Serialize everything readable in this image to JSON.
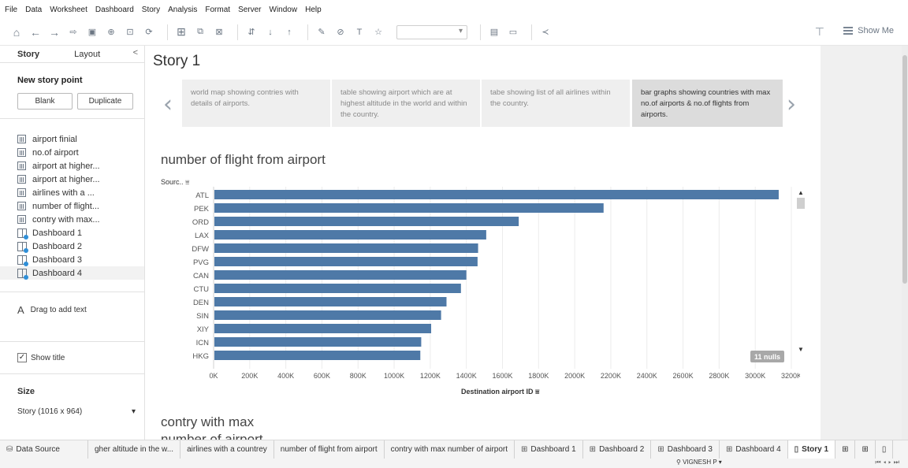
{
  "menu": [
    "File",
    "Data",
    "Worksheet",
    "Dashboard",
    "Story",
    "Analysis",
    "Format",
    "Server",
    "Window",
    "Help"
  ],
  "toolbar": {
    "show_me": "Show Me"
  },
  "left_panel": {
    "tab_story": "Story",
    "tab_layout": "Layout",
    "collapse": "<",
    "new_story_point": "New story point",
    "blank": "Blank",
    "duplicate": "Duplicate",
    "sheets": [
      {
        "label": "airport finial",
        "icon": "worksheet-icon"
      },
      {
        "label": "no.of airport",
        "icon": "worksheet-icon"
      },
      {
        "label": "airport at higher...",
        "icon": "worksheet-icon"
      },
      {
        "label": "airport at higher...",
        "icon": "worksheet-icon"
      },
      {
        "label": "airlines with a ...",
        "icon": "worksheet-icon"
      },
      {
        "label": "number of flight...",
        "icon": "worksheet-icon"
      },
      {
        "label": "contry with max...",
        "icon": "worksheet-icon"
      },
      {
        "label": "Dashboard 1",
        "icon": "dashboard-icon"
      },
      {
        "label": "Dashboard 2",
        "icon": "dashboard-icon"
      },
      {
        "label": "Dashboard 3",
        "icon": "dashboard-icon"
      },
      {
        "label": "Dashboard 4",
        "icon": "dashboard-icon"
      }
    ],
    "drag_text": "Drag to add text",
    "show_title": "Show title",
    "size_heading": "Size",
    "size_value": "Story (1016 x 964)"
  },
  "story": {
    "title": "Story 1",
    "points": [
      "world map showing contries with details of airports.",
      "table showing airport which are at highest altitude in the world and within the country.",
      "tabe showing list of all airlines within the country.",
      "bar graphs showing countries with max no.of airports & no.of flights from airports."
    ],
    "sheet_title": "number of flight from airport",
    "next_sheet_title": "contry with max number of airport",
    "y_header": "Sourc..",
    "x_header": "Destination airport ID",
    "nulls": "11 nulls"
  },
  "chart_data": {
    "type": "bar",
    "orientation": "horizontal",
    "bar_color": "#4e79a7",
    "categories": [
      "ATL",
      "PEK",
      "ORD",
      "LAX",
      "DFW",
      "PVG",
      "CAN",
      "CTU",
      "DEN",
      "SIN",
      "XIY",
      "ICN",
      "HKG"
    ],
    "values": [
      3130,
      2160,
      1690,
      1510,
      1465,
      1462,
      1400,
      1370,
      1290,
      1260,
      1205,
      1150,
      1145
    ],
    "value_unit": "K",
    "xlim": [
      0,
      3200
    ],
    "xticks": [
      "0K",
      "200K",
      "400K",
      "600K",
      "800K",
      "1000K",
      "1200K",
      "1400K",
      "1600K",
      "1800K",
      "2000K",
      "2200K",
      "2400K",
      "2600K",
      "2800K",
      "3000K",
      "3200K"
    ],
    "xlabel": "Destination airport ID",
    "ylabel": "Sourc..",
    "grid": true
  },
  "bottom_tabs": [
    {
      "label": "Data Source",
      "icon": "⛁"
    },
    {
      "label": "gher altitude in the w...",
      "icon": ""
    },
    {
      "label": "airlines with a countrey",
      "icon": ""
    },
    {
      "label": "number of flight from airport",
      "icon": ""
    },
    {
      "label": "contry with max number of airport",
      "icon": ""
    },
    {
      "label": "Dashboard 1",
      "icon": "⊞"
    },
    {
      "label": "Dashboard 2",
      "icon": "⊞"
    },
    {
      "label": "Dashboard 3",
      "icon": "⊞"
    },
    {
      "label": "Dashboard 4",
      "icon": "⊞"
    },
    {
      "label": "Story 1",
      "icon": "▯"
    }
  ],
  "status": {
    "user": "VIGNESH P"
  }
}
